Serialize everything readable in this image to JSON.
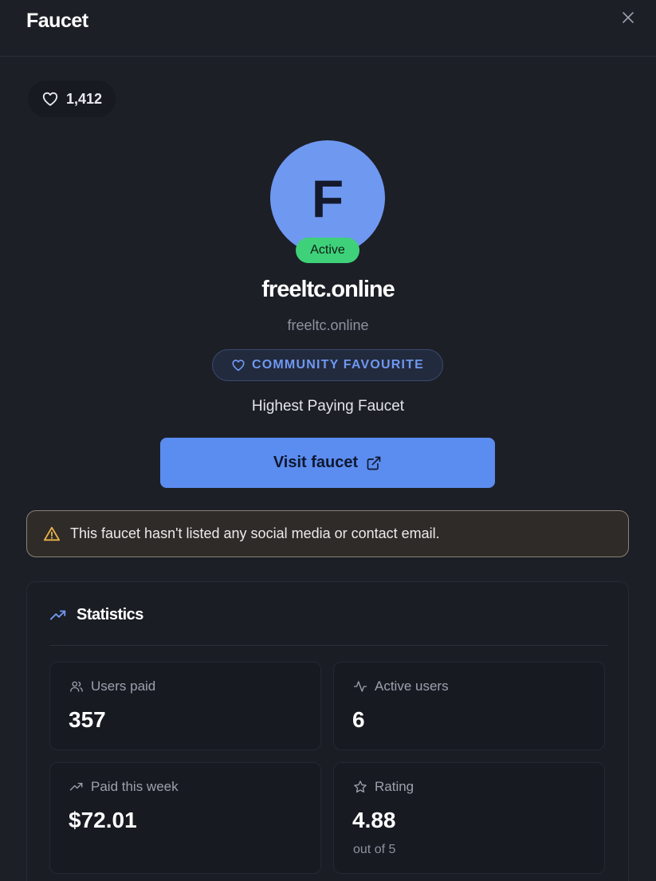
{
  "header": {
    "title": "Faucet"
  },
  "likes": {
    "count": "1,412"
  },
  "profile": {
    "avatar_letter": "F",
    "status": "Active",
    "name": "freeltc.online",
    "url": "freeltc.online",
    "badge": "COMMUNITY FAVOURITE",
    "tagline": "Highest Paying Faucet"
  },
  "actions": {
    "visit_label": "Visit faucet"
  },
  "warning": {
    "text": "This faucet hasn't listed any social media or contact email."
  },
  "statistics": {
    "title": "Statistics",
    "users_paid": {
      "label": "Users paid",
      "value": "357"
    },
    "active_users": {
      "label": "Active users",
      "value": "6"
    },
    "paid_week": {
      "label": "Paid this week",
      "value": "$72.01"
    },
    "rating": {
      "label": "Rating",
      "value": "4.88",
      "sub": "out of 5"
    }
  },
  "colors": {
    "background": "#1c1f26",
    "accent": "#5b8cef",
    "avatar": "#6f98f1",
    "active": "#3ed17a",
    "warning_icon": "#e8b24a"
  },
  "icons": {
    "close": "close-icon",
    "likes": "heart-icon",
    "badge": "heart-icon",
    "visit": "external-link-icon",
    "warning": "warning-triangle-icon",
    "stats": "trending-up-icon",
    "users_paid": "users-icon",
    "active_users": "activity-icon",
    "paid_week": "trending-up-icon",
    "rating": "star-icon"
  }
}
